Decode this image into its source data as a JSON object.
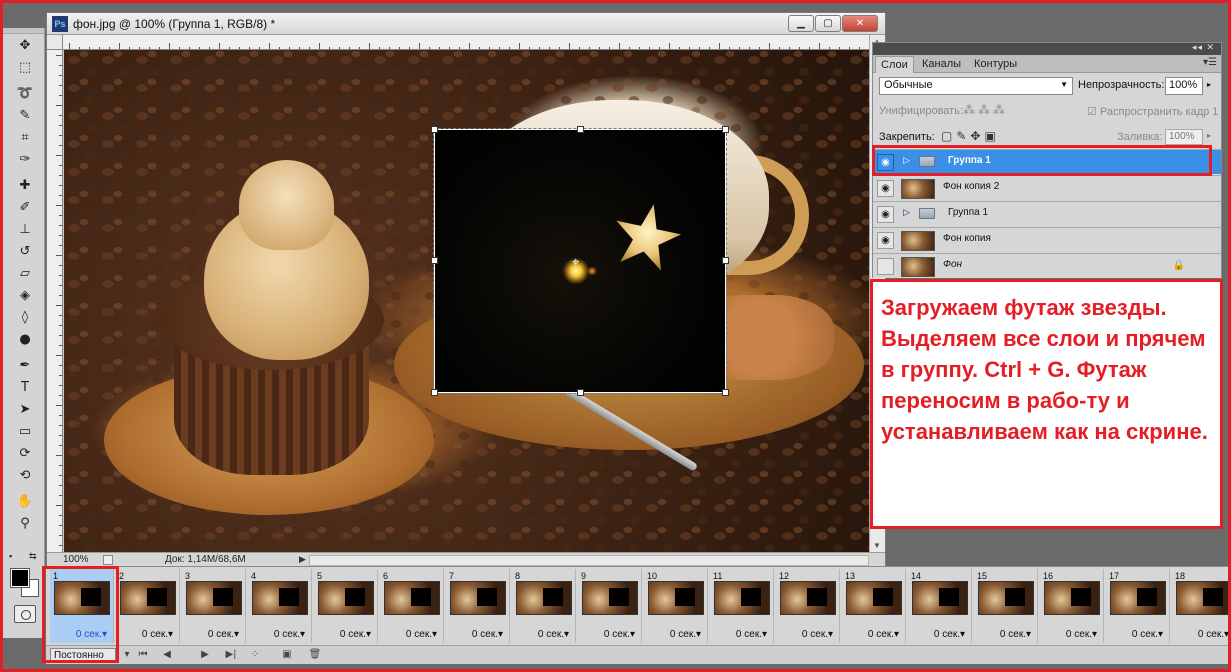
{
  "document": {
    "app_badge": "Ps",
    "title": "фон.jpg @ 100% (Группа 1, RGB/8) *",
    "zoom": "100%",
    "info": "Док: 1,14M/68,6M"
  },
  "window_buttons": {
    "minimize": "▁",
    "maximize": "▢",
    "close": "✕"
  },
  "tools": [
    {
      "name": "move-tool",
      "glyph": "✥"
    },
    {
      "name": "marquee-tool",
      "glyph": "⬚"
    },
    {
      "name": "lasso-tool",
      "glyph": "➰"
    },
    {
      "name": "quick-selection-tool",
      "glyph": "✎"
    },
    {
      "name": "crop-tool",
      "glyph": "⌗"
    },
    {
      "name": "eyedropper-tool",
      "glyph": "✑"
    },
    {
      "name": "spot-healing-tool",
      "glyph": "✚"
    },
    {
      "name": "brush-tool",
      "glyph": "✐"
    },
    {
      "name": "clone-stamp-tool",
      "glyph": "⊥"
    },
    {
      "name": "history-brush-tool",
      "glyph": "↺"
    },
    {
      "name": "eraser-tool",
      "glyph": "▱"
    },
    {
      "name": "paint-bucket-tool",
      "glyph": "◈"
    },
    {
      "name": "blur-tool",
      "glyph": "◊"
    },
    {
      "name": "dodge-tool",
      "glyph": "●"
    },
    {
      "name": "pen-tool",
      "glyph": "✒"
    },
    {
      "name": "type-tool",
      "glyph": "T"
    },
    {
      "name": "path-selection-tool",
      "glyph": "➤"
    },
    {
      "name": "rectangle-tool",
      "glyph": "▭"
    },
    {
      "name": "3d-rotate-tool",
      "glyph": "⟳"
    },
    {
      "name": "3d-orbit-tool",
      "glyph": "⟲"
    },
    {
      "name": "hand-tool",
      "glyph": "✋"
    },
    {
      "name": "zoom-tool",
      "glyph": "⚲"
    }
  ],
  "colors": {
    "foreground": "#000000",
    "background": "#ffffff",
    "mini": "▪",
    "swap": "⇆"
  },
  "layers_panel": {
    "grip_icons": "◂◂ ✕",
    "tabs": [
      "Слои",
      "Каналы",
      "Контуры"
    ],
    "menu_icon": "▾☰",
    "blend_mode": "Обычные",
    "opacity_label": "Непрозрачность:",
    "opacity": "100%",
    "unify_label": "Унифицировать:",
    "unify_icons": "⁂⁂⁂",
    "propagate": "☑ Распространить кадр 1",
    "lock_label": "Закрепить:",
    "lock_icons": "▢✎✥▣",
    "fill_label": "Заливка:",
    "fill": "100%",
    "layers": [
      {
        "name": "Группа 1",
        "type": "group",
        "visible": true,
        "selected": true
      },
      {
        "name": "Фон копия 2",
        "type": "image",
        "visible": true,
        "selected": false
      },
      {
        "name": "Группа 1",
        "type": "group",
        "visible": true,
        "selected": false
      },
      {
        "name": "Фон копия",
        "type": "image",
        "visible": true,
        "selected": false
      },
      {
        "name": "Фон",
        "type": "image",
        "visible": false,
        "selected": false,
        "locked": true
      }
    ],
    "eye_glyph": "◉",
    "lock_glyph": "🔒",
    "tri_glyph": "▷"
  },
  "annotation": {
    "text": "Загружаем футаж звезды. Выделяем все слои и прячем в группу. Ctrl + G. Футаж переносим в рабо-ту и устанавливаем как на скрине."
  },
  "timeline": {
    "frames": [
      {
        "num": "1",
        "delay": "0 сек.▾",
        "selected": true
      },
      {
        "num": "2",
        "delay": "0 сек.▾",
        "selected": false
      },
      {
        "num": "3",
        "delay": "0 сек.▾",
        "selected": false
      },
      {
        "num": "4",
        "delay": "0 сек.▾",
        "selected": false
      },
      {
        "num": "5",
        "delay": "0 сек.▾",
        "selected": false
      },
      {
        "num": "6",
        "delay": "0 сек.▾",
        "selected": false
      },
      {
        "num": "7",
        "delay": "0 сек.▾",
        "selected": false
      },
      {
        "num": "8",
        "delay": "0 сек.▾",
        "selected": false
      },
      {
        "num": "9",
        "delay": "0 сек.▾",
        "selected": false
      },
      {
        "num": "10",
        "delay": "0 сек.▾",
        "selected": false
      },
      {
        "num": "11",
        "delay": "0 сек.▾",
        "selected": false
      },
      {
        "num": "12",
        "delay": "0 сек.▾",
        "selected": false
      },
      {
        "num": "13",
        "delay": "0 сек.▾",
        "selected": false
      },
      {
        "num": "14",
        "delay": "0 сек.▾",
        "selected": false
      },
      {
        "num": "15",
        "delay": "0 сек.▾",
        "selected": false
      },
      {
        "num": "16",
        "delay": "0 сек.▾",
        "selected": false
      },
      {
        "num": "17",
        "delay": "0 сек.▾",
        "selected": false
      },
      {
        "num": "18",
        "delay": "0 сек.▾",
        "selected": false
      }
    ],
    "loop": "Постоянно",
    "controls": [
      {
        "name": "loop-dropdown-caret",
        "glyph": "▾"
      },
      {
        "name": "first-frame-button",
        "glyph": "⏮"
      },
      {
        "name": "previous-frame-button",
        "glyph": "◀"
      },
      {
        "name": "play-button",
        "glyph": "▶"
      },
      {
        "name": "next-frame-button",
        "glyph": "▶|"
      },
      {
        "name": "tween-button",
        "glyph": "⁘"
      },
      {
        "name": "new-frame-button",
        "glyph": "▣"
      },
      {
        "name": "delete-frame-button",
        "glyph": "🗑"
      }
    ]
  }
}
